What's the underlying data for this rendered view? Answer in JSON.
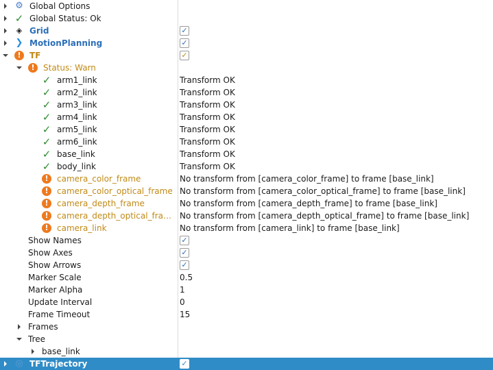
{
  "colors": {
    "selection": "#308cc6",
    "display_name": "#2c6fb8",
    "warn_text": "#c08a17",
    "warn_icon": "#ee7a1e",
    "ok_icon": "#2e8b2e"
  },
  "rows": [
    {
      "level": 0,
      "arrow": "closed",
      "icon": "gear-icon",
      "label": "Global Options"
    },
    {
      "level": 0,
      "arrow": "closed",
      "icon": "check-icon",
      "label": "Global Status: Ok"
    },
    {
      "level": 0,
      "arrow": "closed",
      "icon": "grid-icon",
      "label": "Grid",
      "style": "bold blue",
      "checkbox": true
    },
    {
      "level": 0,
      "arrow": "closed",
      "icon": "motion-planning-icon",
      "label": "MotionPlanning",
      "style": "bold blue",
      "checkbox": true
    },
    {
      "level": 0,
      "arrow": "open",
      "icon": "warning-icon",
      "label": "TF",
      "style": "bold orange",
      "checkbox": true,
      "cbstyle": "orange"
    },
    {
      "level": 1,
      "arrow": "open",
      "icon": "warning-icon",
      "label": "Status: Warn",
      "style": "orange"
    },
    {
      "level": 2,
      "icon": "check-icon",
      "label": "arm1_link",
      "value": "Transform OK"
    },
    {
      "level": 2,
      "icon": "check-icon",
      "label": "arm2_link",
      "value": "Transform OK"
    },
    {
      "level": 2,
      "icon": "check-icon",
      "label": "arm3_link",
      "value": "Transform OK"
    },
    {
      "level": 2,
      "icon": "check-icon",
      "label": "arm4_link",
      "value": "Transform OK"
    },
    {
      "level": 2,
      "icon": "check-icon",
      "label": "arm5_link",
      "value": "Transform OK"
    },
    {
      "level": 2,
      "icon": "check-icon",
      "label": "arm6_link",
      "value": "Transform OK"
    },
    {
      "level": 2,
      "icon": "check-icon",
      "label": "base_link",
      "value": "Transform OK"
    },
    {
      "level": 2,
      "icon": "check-icon",
      "label": "body_link",
      "value": "Transform OK"
    },
    {
      "level": 2,
      "icon": "warning-icon",
      "label": "camera_color_frame",
      "style": "orange",
      "value": "No transform from [camera_color_frame] to frame [base_link]"
    },
    {
      "level": 2,
      "icon": "warning-icon",
      "label": "camera_color_optical_frame",
      "style": "orange",
      "value": "No transform from [camera_color_optical_frame] to frame [base_link]"
    },
    {
      "level": 2,
      "icon": "warning-icon",
      "label": "camera_depth_frame",
      "style": "orange",
      "value": "No transform from [camera_depth_frame] to frame [base_link]"
    },
    {
      "level": 2,
      "icon": "warning-icon",
      "label": "camera_depth_optical_fra…",
      "style": "orange",
      "value": "No transform from [camera_depth_optical_frame] to frame [base_link]"
    },
    {
      "level": 2,
      "icon": "warning-icon",
      "label": "camera_link",
      "style": "orange",
      "value": "No transform from [camera_link] to frame [base_link]"
    },
    {
      "level": 1,
      "label": "Show Names",
      "checkbox": true
    },
    {
      "level": 1,
      "label": "Show Axes",
      "checkbox": true
    },
    {
      "level": 1,
      "label": "Show Arrows",
      "checkbox": true
    },
    {
      "level": 1,
      "label": "Marker Scale",
      "value": "0.5"
    },
    {
      "level": 1,
      "label": "Marker Alpha",
      "value": "1"
    },
    {
      "level": 1,
      "label": "Update Interval",
      "value": "0"
    },
    {
      "level": 1,
      "label": "Frame Timeout",
      "value": "15"
    },
    {
      "level": 1,
      "arrow": "closed",
      "label": "Frames"
    },
    {
      "level": 1,
      "arrow": "open",
      "label": "Tree"
    },
    {
      "level": 2,
      "arrow": "closed",
      "label": "base_link"
    },
    {
      "level": 0,
      "arrow": "closed",
      "icon": "trajectory-icon",
      "label": "TFTrajectory",
      "style": "bold",
      "checkbox": true,
      "cbstyle": "white",
      "selected": true
    }
  ]
}
